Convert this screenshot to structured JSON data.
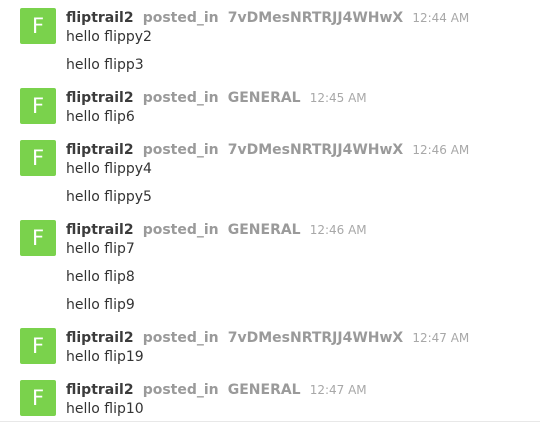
{
  "messages": [
    {
      "avatar_letter": "F",
      "username": "fliptrail2",
      "posted_in": "posted_in",
      "channel": "7vDMesNRTRJJ4WHwX",
      "time": "12:44 AM",
      "lines": [
        "hello flippy2",
        "hello flipp3"
      ]
    },
    {
      "avatar_letter": "F",
      "username": "fliptrail2",
      "posted_in": "posted_in",
      "channel": "GENERAL",
      "time": "12:45 AM",
      "lines": [
        "hello flip6"
      ]
    },
    {
      "avatar_letter": "F",
      "username": "fliptrail2",
      "posted_in": "posted_in",
      "channel": "7vDMesNRTRJJ4WHwX",
      "time": "12:46 AM",
      "lines": [
        "hello flippy4",
        "hello flippy5"
      ]
    },
    {
      "avatar_letter": "F",
      "username": "fliptrail2",
      "posted_in": "posted_in",
      "channel": "GENERAL",
      "time": "12:46 AM",
      "lines": [
        "hello flip7",
        "hello flip8",
        "hello flip9"
      ]
    },
    {
      "avatar_letter": "F",
      "username": "fliptrail2",
      "posted_in": "posted_in",
      "channel": "7vDMesNRTRJJ4WHwX",
      "time": "12:47 AM",
      "lines": [
        "hello flip19"
      ]
    },
    {
      "avatar_letter": "F",
      "username": "fliptrail2",
      "posted_in": "posted_in",
      "channel": "GENERAL",
      "time": "12:47 AM",
      "lines": [
        "hello flip10"
      ]
    }
  ],
  "colors": {
    "avatar_bg": "#7ad24c",
    "username": "#3c3c3c",
    "meta": "#9a9a9a",
    "body_text": "#333333"
  }
}
